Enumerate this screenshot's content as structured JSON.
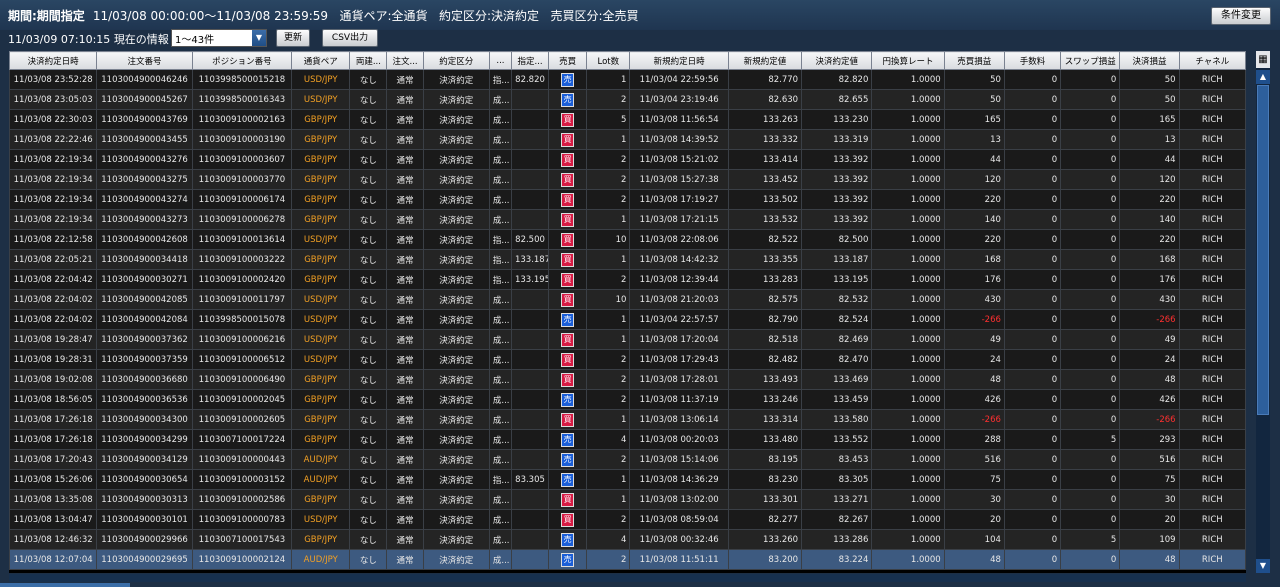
{
  "header": {
    "period_label": "期間:期間指定",
    "period_value": "11/03/08 00:00:00〜11/03/08 23:59:59",
    "pair": "通貨ペア:全通貨",
    "trade_type": "約定区分:決済約定",
    "buysell_type": "売買区分:全売買",
    "condition_button": "条件変更"
  },
  "toolbar": {
    "now": "11/03/09 07:10:15",
    "now_label": "現在の情報",
    "range_select": "1〜43件",
    "refresh_button": "更新",
    "csv_button": "CSV出力"
  },
  "columns": [
    "決済約定日時",
    "注文番号",
    "ポジション番号",
    "通貨ペア",
    "両建...",
    "注文...",
    "約定区分",
    "...",
    "指定...",
    "売買",
    "Lot数",
    "新規約定日時",
    "新規約定値",
    "決済約定値",
    "円換算レート",
    "売買損益",
    "手数料",
    "スワップ損益",
    "決済損益",
    "チャネル"
  ],
  "settings_icon": "grid-config-icon",
  "rows": [
    {
      "dt": "11/03/08 23:52:28",
      "order": "1103004900046246",
      "pos": "1103998500015218",
      "pair": "USD/JPY",
      "hedge": "なし",
      "otype": "通常",
      "ctype": "決済約定",
      "exec": "指...",
      "spec": "82.820",
      "bs": "売",
      "lot": "1",
      "open_dt": "11/03/04 22:59:56",
      "open_px": "82.770",
      "close_px": "82.820",
      "rate": "1.0000",
      "pl": "50",
      "fee": "0",
      "swap": "0",
      "net": "50",
      "ch": "RICH"
    },
    {
      "dt": "11/03/08 23:05:03",
      "order": "1103004900045267",
      "pos": "1103998500016343",
      "pair": "USD/JPY",
      "hedge": "なし",
      "otype": "通常",
      "ctype": "決済約定",
      "exec": "成...",
      "spec": "",
      "bs": "売",
      "lot": "2",
      "open_dt": "11/03/04 23:19:46",
      "open_px": "82.630",
      "close_px": "82.655",
      "rate": "1.0000",
      "pl": "50",
      "fee": "0",
      "swap": "0",
      "net": "50",
      "ch": "RICH"
    },
    {
      "dt": "11/03/08 22:30:03",
      "order": "1103004900043769",
      "pos": "1103009100002163",
      "pair": "GBP/JPY",
      "hedge": "なし",
      "otype": "通常",
      "ctype": "決済約定",
      "exec": "成...",
      "spec": "",
      "bs": "買",
      "lot": "5",
      "open_dt": "11/03/08 11:56:54",
      "open_px": "133.263",
      "close_px": "133.230",
      "rate": "1.0000",
      "pl": "165",
      "fee": "0",
      "swap": "0",
      "net": "165",
      "ch": "RICH"
    },
    {
      "dt": "11/03/08 22:22:46",
      "order": "1103004900043455",
      "pos": "1103009100003190",
      "pair": "GBP/JPY",
      "hedge": "なし",
      "otype": "通常",
      "ctype": "決済約定",
      "exec": "成...",
      "spec": "",
      "bs": "買",
      "lot": "1",
      "open_dt": "11/03/08 14:39:52",
      "open_px": "133.332",
      "close_px": "133.319",
      "rate": "1.0000",
      "pl": "13",
      "fee": "0",
      "swap": "0",
      "net": "13",
      "ch": "RICH"
    },
    {
      "dt": "11/03/08 22:19:34",
      "order": "1103004900043276",
      "pos": "1103009100003607",
      "pair": "GBP/JPY",
      "hedge": "なし",
      "otype": "通常",
      "ctype": "決済約定",
      "exec": "成...",
      "spec": "",
      "bs": "買",
      "lot": "2",
      "open_dt": "11/03/08 15:21:02",
      "open_px": "133.414",
      "close_px": "133.392",
      "rate": "1.0000",
      "pl": "44",
      "fee": "0",
      "swap": "0",
      "net": "44",
      "ch": "RICH"
    },
    {
      "dt": "11/03/08 22:19:34",
      "order": "1103004900043275",
      "pos": "1103009100003770",
      "pair": "GBP/JPY",
      "hedge": "なし",
      "otype": "通常",
      "ctype": "決済約定",
      "exec": "成...",
      "spec": "",
      "bs": "買",
      "lot": "2",
      "open_dt": "11/03/08 15:27:38",
      "open_px": "133.452",
      "close_px": "133.392",
      "rate": "1.0000",
      "pl": "120",
      "fee": "0",
      "swap": "0",
      "net": "120",
      "ch": "RICH"
    },
    {
      "dt": "11/03/08 22:19:34",
      "order": "1103004900043274",
      "pos": "1103009100006174",
      "pair": "GBP/JPY",
      "hedge": "なし",
      "otype": "通常",
      "ctype": "決済約定",
      "exec": "成...",
      "spec": "",
      "bs": "買",
      "lot": "2",
      "open_dt": "11/03/08 17:19:27",
      "open_px": "133.502",
      "close_px": "133.392",
      "rate": "1.0000",
      "pl": "220",
      "fee": "0",
      "swap": "0",
      "net": "220",
      "ch": "RICH"
    },
    {
      "dt": "11/03/08 22:19:34",
      "order": "1103004900043273",
      "pos": "1103009100006278",
      "pair": "GBP/JPY",
      "hedge": "なし",
      "otype": "通常",
      "ctype": "決済約定",
      "exec": "成...",
      "spec": "",
      "bs": "買",
      "lot": "1",
      "open_dt": "11/03/08 17:21:15",
      "open_px": "133.532",
      "close_px": "133.392",
      "rate": "1.0000",
      "pl": "140",
      "fee": "0",
      "swap": "0",
      "net": "140",
      "ch": "RICH"
    },
    {
      "dt": "11/03/08 22:12:58",
      "order": "1103004900042608",
      "pos": "1103009100013614",
      "pair": "USD/JPY",
      "hedge": "なし",
      "otype": "通常",
      "ctype": "決済約定",
      "exec": "指...",
      "spec": "82.500",
      "bs": "買",
      "lot": "10",
      "open_dt": "11/03/08 22:08:06",
      "open_px": "82.522",
      "close_px": "82.500",
      "rate": "1.0000",
      "pl": "220",
      "fee": "0",
      "swap": "0",
      "net": "220",
      "ch": "RICH"
    },
    {
      "dt": "11/03/08 22:05:21",
      "order": "1103004900034418",
      "pos": "1103009100003222",
      "pair": "GBP/JPY",
      "hedge": "なし",
      "otype": "通常",
      "ctype": "決済約定",
      "exec": "指...",
      "spec": "133.187",
      "bs": "買",
      "lot": "1",
      "open_dt": "11/03/08 14:42:32",
      "open_px": "133.355",
      "close_px": "133.187",
      "rate": "1.0000",
      "pl": "168",
      "fee": "0",
      "swap": "0",
      "net": "168",
      "ch": "RICH"
    },
    {
      "dt": "11/03/08 22:04:42",
      "order": "1103004900030271",
      "pos": "1103009100002420",
      "pair": "GBP/JPY",
      "hedge": "なし",
      "otype": "通常",
      "ctype": "決済約定",
      "exec": "指...",
      "spec": "133.195",
      "bs": "買",
      "lot": "2",
      "open_dt": "11/03/08 12:39:44",
      "open_px": "133.283",
      "close_px": "133.195",
      "rate": "1.0000",
      "pl": "176",
      "fee": "0",
      "swap": "0",
      "net": "176",
      "ch": "RICH"
    },
    {
      "dt": "11/03/08 22:04:02",
      "order": "1103004900042085",
      "pos": "1103009100011797",
      "pair": "USD/JPY",
      "hedge": "なし",
      "otype": "通常",
      "ctype": "決済約定",
      "exec": "成...",
      "spec": "",
      "bs": "買",
      "lot": "10",
      "open_dt": "11/03/08 21:20:03",
      "open_px": "82.575",
      "close_px": "82.532",
      "rate": "1.0000",
      "pl": "430",
      "fee": "0",
      "swap": "0",
      "net": "430",
      "ch": "RICH"
    },
    {
      "dt": "11/03/08 22:04:02",
      "order": "1103004900042084",
      "pos": "1103998500015078",
      "pair": "USD/JPY",
      "hedge": "なし",
      "otype": "通常",
      "ctype": "決済約定",
      "exec": "成...",
      "spec": "",
      "bs": "売",
      "lot": "1",
      "open_dt": "11/03/04 22:57:57",
      "open_px": "82.790",
      "close_px": "82.524",
      "rate": "1.0000",
      "pl": "-266",
      "fee": "0",
      "swap": "0",
      "net": "-266",
      "ch": "RICH"
    },
    {
      "dt": "11/03/08 19:28:47",
      "order": "1103004900037362",
      "pos": "1103009100006216",
      "pair": "USD/JPY",
      "hedge": "なし",
      "otype": "通常",
      "ctype": "決済約定",
      "exec": "成...",
      "spec": "",
      "bs": "買",
      "lot": "1",
      "open_dt": "11/03/08 17:20:04",
      "open_px": "82.518",
      "close_px": "82.469",
      "rate": "1.0000",
      "pl": "49",
      "fee": "0",
      "swap": "0",
      "net": "49",
      "ch": "RICH"
    },
    {
      "dt": "11/03/08 19:28:31",
      "order": "1103004900037359",
      "pos": "1103009100006512",
      "pair": "USD/JPY",
      "hedge": "なし",
      "otype": "通常",
      "ctype": "決済約定",
      "exec": "成...",
      "spec": "",
      "bs": "買",
      "lot": "2",
      "open_dt": "11/03/08 17:29:43",
      "open_px": "82.482",
      "close_px": "82.470",
      "rate": "1.0000",
      "pl": "24",
      "fee": "0",
      "swap": "0",
      "net": "24",
      "ch": "RICH"
    },
    {
      "dt": "11/03/08 19:02:08",
      "order": "1103004900036680",
      "pos": "1103009100006490",
      "pair": "GBP/JPY",
      "hedge": "なし",
      "otype": "通常",
      "ctype": "決済約定",
      "exec": "成...",
      "spec": "",
      "bs": "買",
      "lot": "2",
      "open_dt": "11/03/08 17:28:01",
      "open_px": "133.493",
      "close_px": "133.469",
      "rate": "1.0000",
      "pl": "48",
      "fee": "0",
      "swap": "0",
      "net": "48",
      "ch": "RICH"
    },
    {
      "dt": "11/03/08 18:56:05",
      "order": "1103004900036536",
      "pos": "1103009100002045",
      "pair": "GBP/JPY",
      "hedge": "なし",
      "otype": "通常",
      "ctype": "決済約定",
      "exec": "成...",
      "spec": "",
      "bs": "売",
      "lot": "2",
      "open_dt": "11/03/08 11:37:19",
      "open_px": "133.246",
      "close_px": "133.459",
      "rate": "1.0000",
      "pl": "426",
      "fee": "0",
      "swap": "0",
      "net": "426",
      "ch": "RICH"
    },
    {
      "dt": "11/03/08 17:26:18",
      "order": "1103004900034300",
      "pos": "1103009100002605",
      "pair": "GBP/JPY",
      "hedge": "なし",
      "otype": "通常",
      "ctype": "決済約定",
      "exec": "成...",
      "spec": "",
      "bs": "買",
      "lot": "1",
      "open_dt": "11/03/08 13:06:14",
      "open_px": "133.314",
      "close_px": "133.580",
      "rate": "1.0000",
      "pl": "-266",
      "fee": "0",
      "swap": "0",
      "net": "-266",
      "ch": "RICH"
    },
    {
      "dt": "11/03/08 17:26:18",
      "order": "1103004900034299",
      "pos": "1103007100017224",
      "pair": "GBP/JPY",
      "hedge": "なし",
      "otype": "通常",
      "ctype": "決済約定",
      "exec": "成...",
      "spec": "",
      "bs": "売",
      "lot": "4",
      "open_dt": "11/03/08 00:20:03",
      "open_px": "133.480",
      "close_px": "133.552",
      "rate": "1.0000",
      "pl": "288",
      "fee": "0",
      "swap": "5",
      "net": "293",
      "ch": "RICH"
    },
    {
      "dt": "11/03/08 17:20:43",
      "order": "1103004900034129",
      "pos": "1103009100000443",
      "pair": "AUD/JPY",
      "hedge": "なし",
      "otype": "通常",
      "ctype": "決済約定",
      "exec": "成...",
      "spec": "",
      "bs": "売",
      "lot": "2",
      "open_dt": "11/03/08 15:14:06",
      "open_px": "83.195",
      "close_px": "83.453",
      "rate": "1.0000",
      "pl": "516",
      "fee": "0",
      "swap": "0",
      "net": "516",
      "ch": "RICH"
    },
    {
      "dt": "11/03/08 15:26:06",
      "order": "1103004900030654",
      "pos": "1103009100003152",
      "pair": "AUD/JPY",
      "hedge": "なし",
      "otype": "通常",
      "ctype": "決済約定",
      "exec": "指...",
      "spec": "83.305",
      "bs": "売",
      "lot": "1",
      "open_dt": "11/03/08 14:36:29",
      "open_px": "83.230",
      "close_px": "83.305",
      "rate": "1.0000",
      "pl": "75",
      "fee": "0",
      "swap": "0",
      "net": "75",
      "ch": "RICH"
    },
    {
      "dt": "11/03/08 13:35:08",
      "order": "1103004900030313",
      "pos": "1103009100002586",
      "pair": "GBP/JPY",
      "hedge": "なし",
      "otype": "通常",
      "ctype": "決済約定",
      "exec": "成...",
      "spec": "",
      "bs": "買",
      "lot": "1",
      "open_dt": "11/03/08 13:02:00",
      "open_px": "133.301",
      "close_px": "133.271",
      "rate": "1.0000",
      "pl": "30",
      "fee": "0",
      "swap": "0",
      "net": "30",
      "ch": "RICH"
    },
    {
      "dt": "11/03/08 13:04:47",
      "order": "1103004900030101",
      "pos": "1103009100000783",
      "pair": "USD/JPY",
      "hedge": "なし",
      "otype": "通常",
      "ctype": "決済約定",
      "exec": "成...",
      "spec": "",
      "bs": "買",
      "lot": "2",
      "open_dt": "11/03/08 08:59:04",
      "open_px": "82.277",
      "close_px": "82.267",
      "rate": "1.0000",
      "pl": "20",
      "fee": "0",
      "swap": "0",
      "net": "20",
      "ch": "RICH"
    },
    {
      "dt": "11/03/08 12:46:32",
      "order": "1103004900029966",
      "pos": "1103007100017543",
      "pair": "GBP/JPY",
      "hedge": "なし",
      "otype": "通常",
      "ctype": "決済約定",
      "exec": "成...",
      "spec": "",
      "bs": "売",
      "lot": "4",
      "open_dt": "11/03/08 00:32:46",
      "open_px": "133.260",
      "close_px": "133.286",
      "rate": "1.0000",
      "pl": "104",
      "fee": "0",
      "swap": "5",
      "net": "109",
      "ch": "RICH"
    },
    {
      "dt": "11/03/08 12:07:04",
      "order": "1103004900029695",
      "pos": "1103009100002124",
      "pair": "AUD/JPY",
      "hedge": "なし",
      "otype": "通常",
      "ctype": "決済約定",
      "exec": "成...",
      "spec": "",
      "bs": "売",
      "lot": "2",
      "open_dt": "11/03/08 11:51:11",
      "open_px": "83.200",
      "close_px": "83.224",
      "rate": "1.0000",
      "pl": "48",
      "fee": "0",
      "swap": "0",
      "net": "48",
      "ch": "RICH",
      "selected": true
    }
  ]
}
